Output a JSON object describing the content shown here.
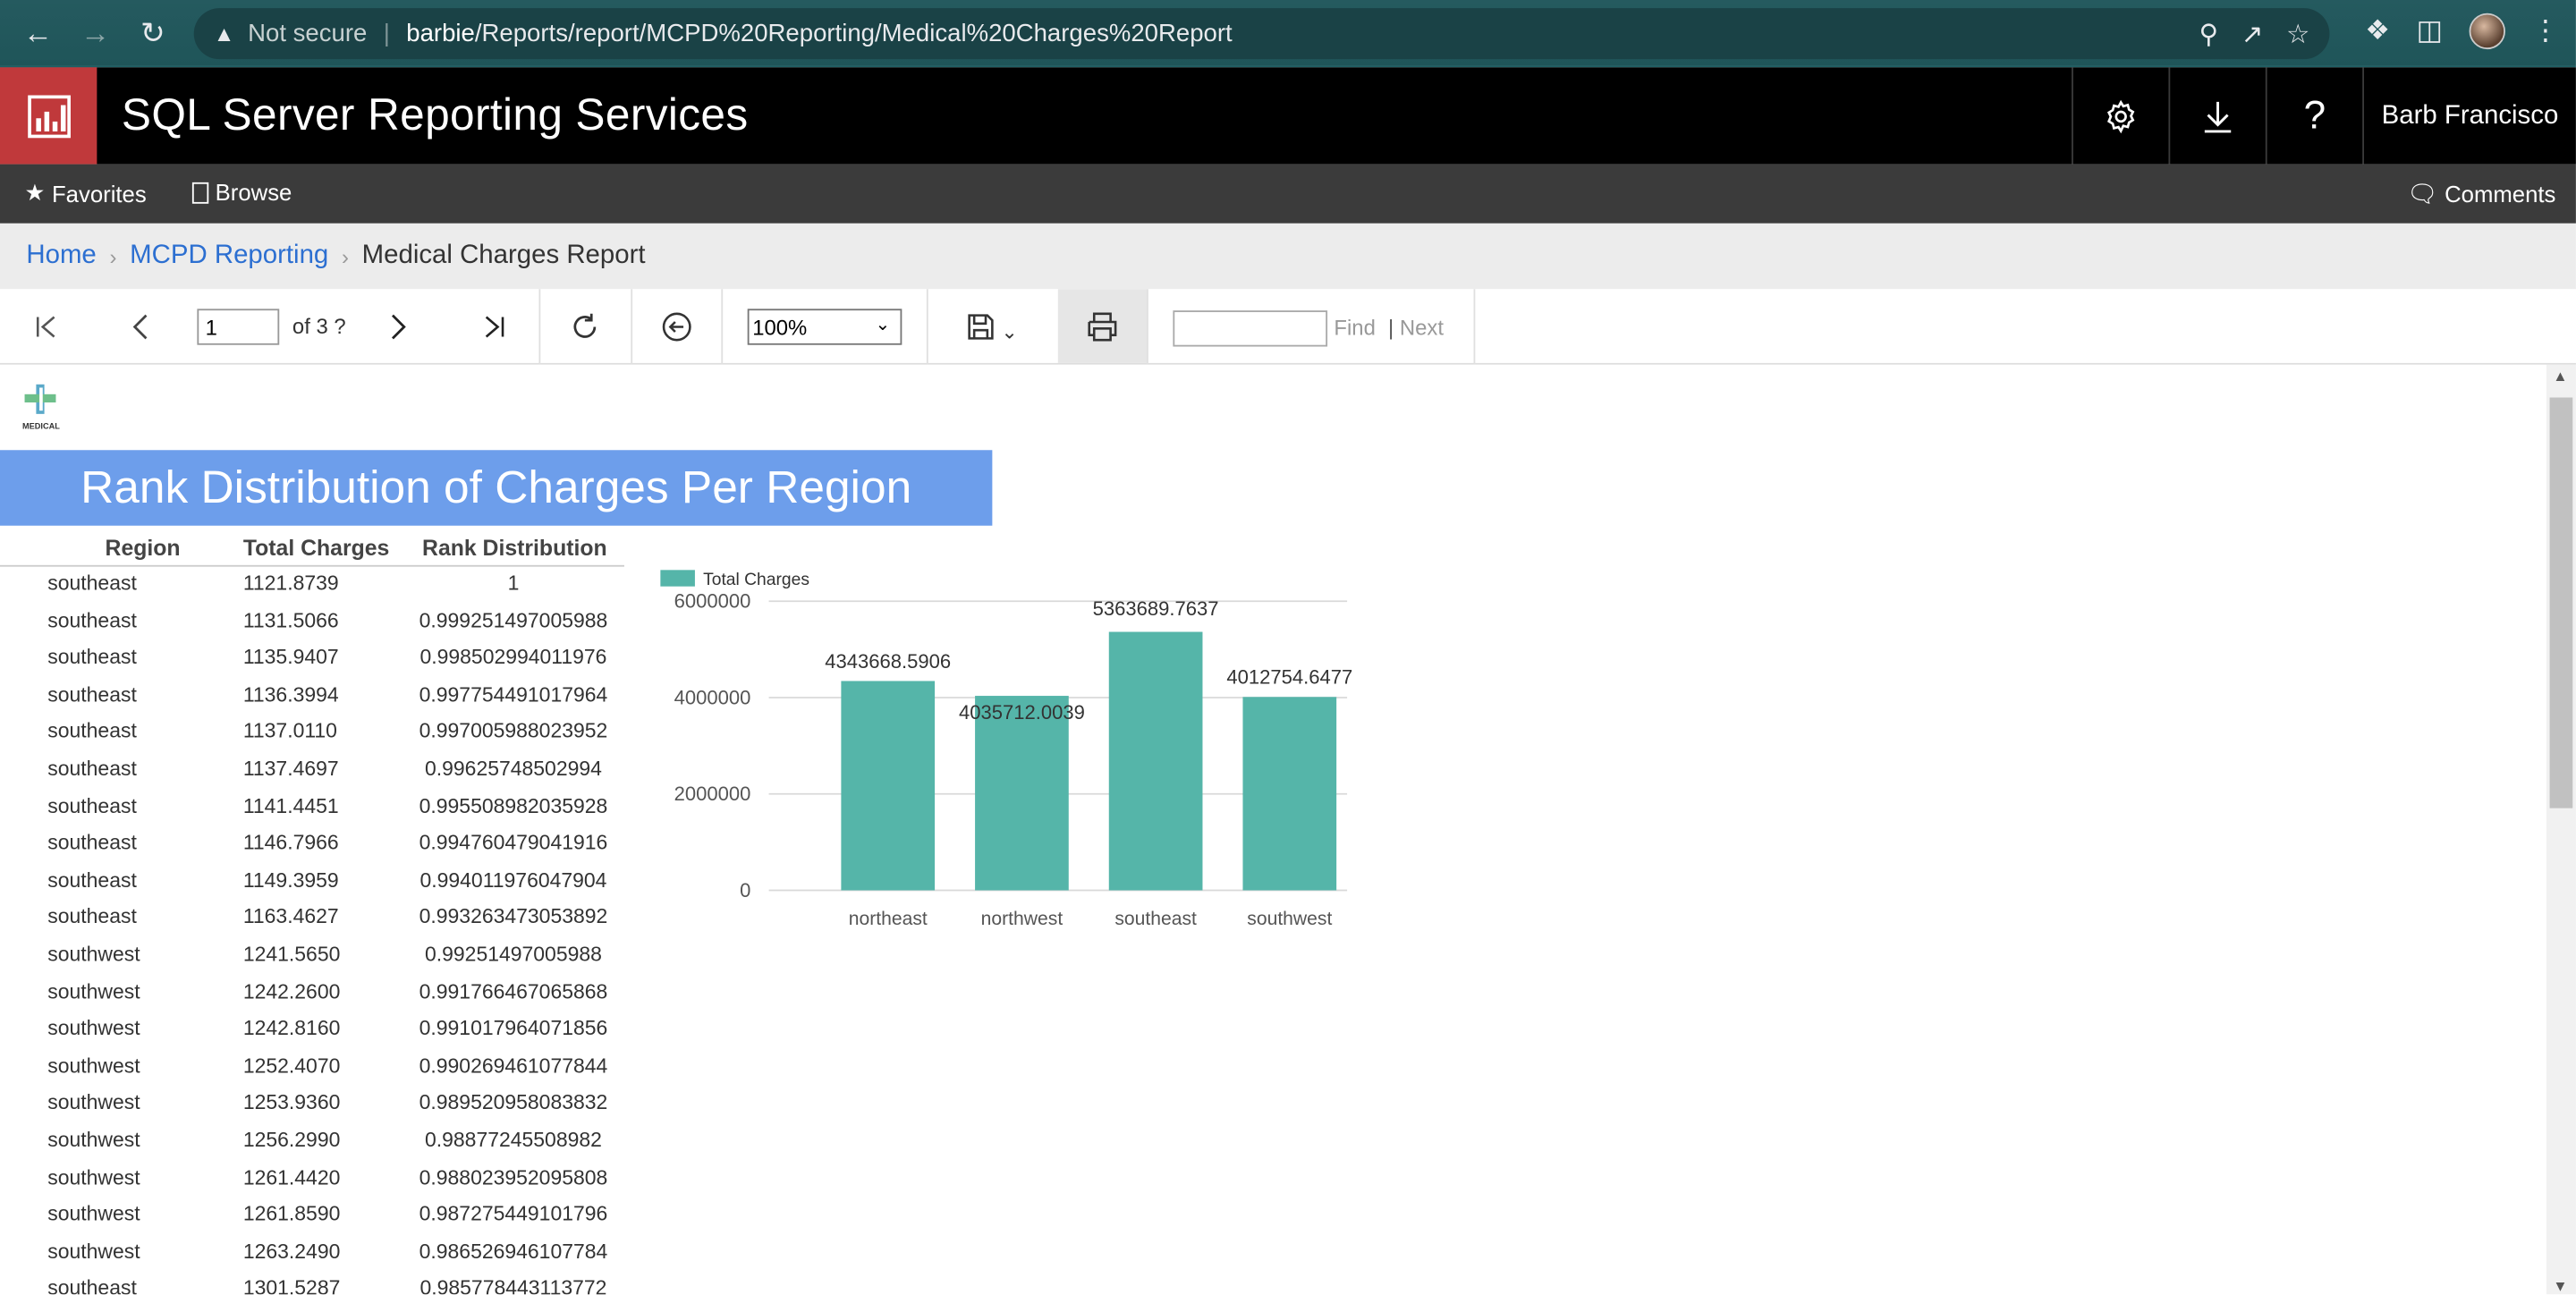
{
  "browser": {
    "security": "Not secure",
    "url_host": "barbie",
    "url_path": "/Reports/report/MCPD%20Reporting/Medical%20Charges%20Report"
  },
  "header": {
    "title": "SQL Server Reporting Services",
    "user": "Barb Francisco",
    "icons": [
      "gear-icon",
      "download-icon",
      "help-icon"
    ]
  },
  "subnav": {
    "favorites": "Favorites",
    "browse": "Browse",
    "comments": "Comments"
  },
  "breadcrumb": {
    "home": "Home",
    "folder": "MCPD Reporting",
    "current": "Medical Charges Report"
  },
  "toolbar": {
    "page": "1",
    "of_pages": "of 3 ?",
    "zoom": "100%",
    "find": "Find",
    "next": "Next",
    "find_placeholder": ""
  },
  "report": {
    "logo_text": "MEDICAL",
    "title": "Rank Distribution of Charges Per Region",
    "columns": [
      "Region",
      "Total Charges",
      "Rank Distribution"
    ],
    "rows": [
      [
        "southeast",
        "1121.8739",
        "1"
      ],
      [
        "southeast",
        "1131.5066",
        "0.999251497005988"
      ],
      [
        "southeast",
        "1135.9407",
        "0.998502994011976"
      ],
      [
        "southeast",
        "1136.3994",
        "0.997754491017964"
      ],
      [
        "southeast",
        "1137.0110",
        "0.997005988023952"
      ],
      [
        "southeast",
        "1137.4697",
        "0.99625748502994"
      ],
      [
        "southeast",
        "1141.4451",
        "0.995508982035928"
      ],
      [
        "southeast",
        "1146.7966",
        "0.994760479041916"
      ],
      [
        "southeast",
        "1149.3959",
        "0.994011976047904"
      ],
      [
        "southeast",
        "1163.4627",
        "0.993263473053892"
      ],
      [
        "southwest",
        "1241.5650",
        "0.99251497005988"
      ],
      [
        "southwest",
        "1242.2600",
        "0.991766467065868"
      ],
      [
        "southwest",
        "1242.8160",
        "0.991017964071856"
      ],
      [
        "southwest",
        "1252.4070",
        "0.990269461077844"
      ],
      [
        "southwest",
        "1253.9360",
        "0.989520958083832"
      ],
      [
        "southwest",
        "1256.2990",
        "0.98877245508982"
      ],
      [
        "southwest",
        "1261.4420",
        "0.988023952095808"
      ],
      [
        "southwest",
        "1261.8590",
        "0.987275449101796"
      ],
      [
        "southwest",
        "1263.2490",
        "0.986526946107784"
      ],
      [
        "southeast",
        "1301.5287",
        "0.985778443113772"
      ]
    ]
  },
  "chart_data": {
    "type": "bar",
    "categories": [
      "northeast",
      "northwest",
      "southeast",
      "southwest"
    ],
    "series": [
      {
        "name": "Total Charges",
        "values": [
          4343668.5906,
          4035712.0039,
          5363689.7637,
          4012754.6477
        ]
      }
    ],
    "data_labels": [
      "4343668.5906",
      "4035712.0039",
      "5363689.7637",
      "4012754.6477"
    ],
    "y_ticks": [
      "0",
      "2000000",
      "4000000",
      "6000000"
    ],
    "ylim": [
      0,
      6000000
    ],
    "legend_position": "top-left",
    "grid": true,
    "color": "#55b5a9"
  }
}
